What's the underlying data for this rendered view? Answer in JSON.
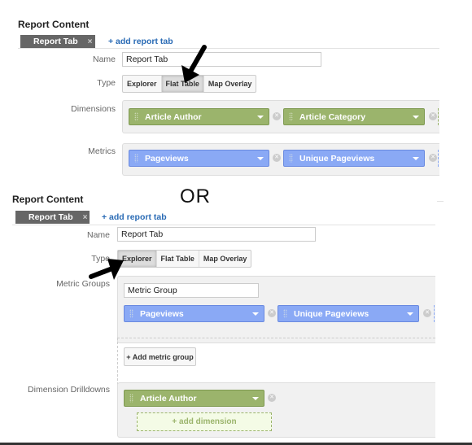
{
  "option1": {
    "section_title": "Report Content",
    "tab": {
      "label": "Report Tab",
      "close": "×"
    },
    "add_tab": "+ add report tab",
    "name_label": "Name",
    "name_value": "Report Tab",
    "type_label": "Type",
    "type_options": [
      "Explorer",
      "Flat Table",
      "Map Overlay"
    ],
    "type_selected": "Flat Table",
    "dimensions_label": "Dimensions",
    "dimensions": [
      "Article Author",
      "Article Category"
    ],
    "metrics_label": "Metrics",
    "metrics": [
      "Pageviews",
      "Unique Pageviews"
    ]
  },
  "separator": "OR",
  "option2": {
    "section_title": "Report Content",
    "tab": {
      "label": "Report Tab",
      "close": "×"
    },
    "add_tab": "+ add report tab",
    "name_label": "Name",
    "name_value": "Report Tab",
    "type_label": "Type",
    "type_options": [
      "Explorer",
      "Flat Table",
      "Map Overlay"
    ],
    "type_selected": "Explorer",
    "metric_groups_label": "Metric Groups",
    "metric_group_name": "Metric Group",
    "metrics": [
      "Pageviews",
      "Unique Pageviews"
    ],
    "add_metric_group": "+ Add metric group",
    "dimension_drilldowns_label": "Dimension Drilldowns",
    "dimensions": [
      "Article Author"
    ],
    "add_dimension": "+ add dimension"
  },
  "colors": {
    "dimension_chip": "#9bb46c",
    "metric_chip": "#8aa9f5",
    "tab": "#666666",
    "link": "#2a6bb5"
  },
  "icons": [
    "close-icon",
    "drag-grip-icon",
    "dropdown-caret-icon",
    "remove-circle-icon",
    "arrow-annotation-icon"
  ]
}
